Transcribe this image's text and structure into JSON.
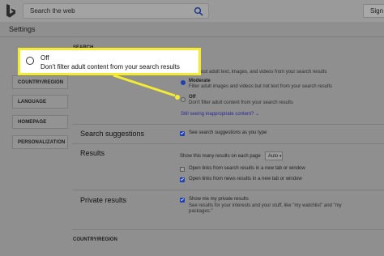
{
  "topbar": {
    "search_placeholder": "Search the web",
    "signin_label": "Sign in"
  },
  "page": {
    "title": "Settings"
  },
  "nav": {
    "items": [
      "COUNTRY/REGION",
      "LANGUAGE",
      "HOMEPAGE",
      "PERSONALIZATION"
    ]
  },
  "safesearch": {
    "section_header": "SEARCH",
    "strict_desc": "Filter out adult text, images, and videos from your search results",
    "moderate_label": "Moderate",
    "moderate_desc": "Filter adult images and videos but not text from your search results",
    "off_label": "Off",
    "off_desc": "Don't filter adult content from your search results",
    "inappropriate_link": "Still seeing inappropriate content?",
    "selected": "Moderate"
  },
  "suggestions": {
    "label": "Search suggestions",
    "option": "See search suggestions as you type",
    "checked": true
  },
  "results": {
    "label": "Results",
    "per_page_label": "Show this many results on each page",
    "per_page_value": "Auto",
    "open_search_links": "Open links from search results in a new tab or window",
    "open_search_checked": false,
    "open_news_links": "Open links from news results in a new tab or window",
    "open_news_checked": true
  },
  "private_results": {
    "label": "Private results",
    "option": "Show me my private results",
    "desc_line1": "See results for your interests and your stuff, like \"my watchlist\" and \"my",
    "desc_line2": "packages.\"",
    "checked": true
  },
  "country": {
    "section_header": "COUNTRY/REGION"
  },
  "callout": {
    "title": "Off",
    "subtitle": "Don't filter adult content from your search results"
  },
  "colors": {
    "highlight": "#f3ec33",
    "accent": "#1f3fb3"
  }
}
